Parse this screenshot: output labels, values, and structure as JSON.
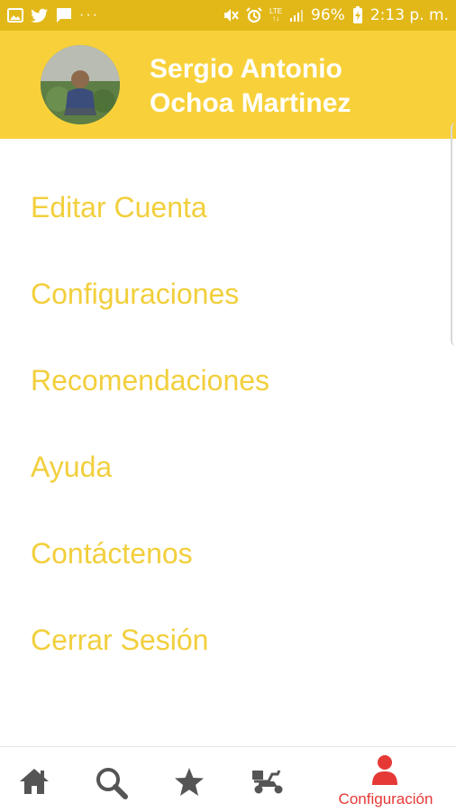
{
  "status_bar": {
    "left_icons": [
      "image-icon",
      "twitter-icon",
      "message-icon",
      "more-dots-icon"
    ],
    "right_icons": [
      "mute-icon",
      "alarm-icon",
      "lte-icon",
      "signal-icon",
      "battery-charging-icon"
    ],
    "network": "LTE",
    "battery": "96%",
    "time": "2:13 p. m."
  },
  "header": {
    "user_name_line1": "Sergio Antonio",
    "user_name_line2": "Ochoa Martinez"
  },
  "menu": {
    "items": [
      {
        "label": "Editar Cuenta"
      },
      {
        "label": "Configuraciones"
      },
      {
        "label": "Recomendaciones"
      },
      {
        "label": "Ayuda"
      },
      {
        "label": "Contáctenos"
      },
      {
        "label": "Cerrar Sesión"
      }
    ]
  },
  "bottom_nav": {
    "items": [
      {
        "icon": "home-icon",
        "label": ""
      },
      {
        "icon": "search-icon",
        "label": ""
      },
      {
        "icon": "star-icon",
        "label": ""
      },
      {
        "icon": "scooter-icon",
        "label": ""
      },
      {
        "icon": "person-icon",
        "label": "Configuración",
        "active": true
      }
    ]
  },
  "colors": {
    "status_bar": "#e2b819",
    "header": "#f8d13a",
    "menu_text": "#f2cf3c",
    "nav_inactive": "#555555",
    "nav_active": "#e53935"
  }
}
